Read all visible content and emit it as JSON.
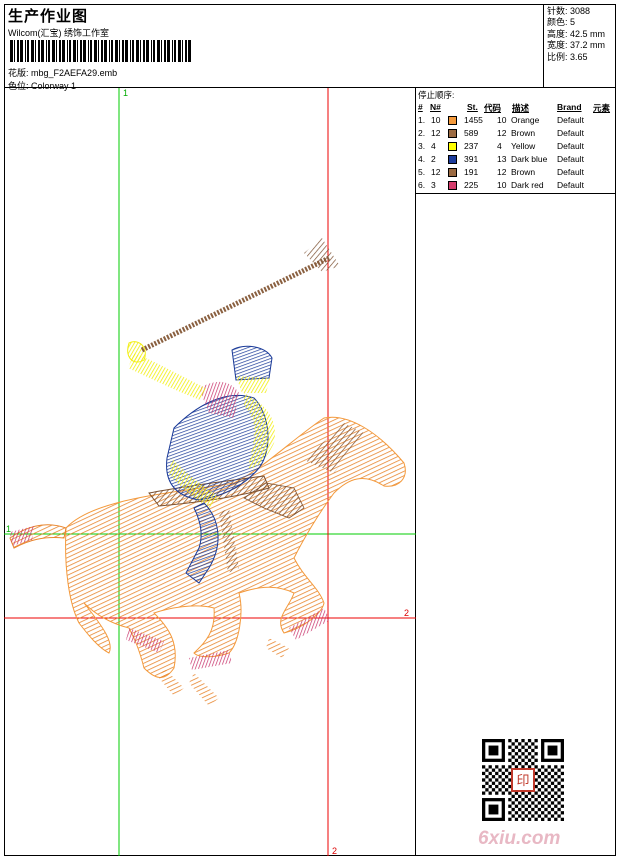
{
  "header": {
    "title": "生产作业图",
    "studio": "Wilcom(汇宝) 绣饰工作室",
    "file_label": "花版:",
    "file_name": "mbg_F2AEFA29.emb",
    "colorway_label": "色位:",
    "colorway": "Colorway 1"
  },
  "specs": [
    {
      "label": "针数:",
      "value": "3088"
    },
    {
      "label": "颜色:",
      "value": "5"
    },
    {
      "label": "高度:",
      "value": "42.5 mm"
    },
    {
      "label": "宽度:",
      "value": "37.2 mm"
    },
    {
      "label": "比例:",
      "value": "3.65"
    }
  ],
  "stop_sequence": {
    "title": "停止顺序:",
    "columns": [
      "#",
      "N#",
      "St.",
      "代码",
      "描述",
      "Brand",
      "元素"
    ],
    "rows": [
      {
        "idx": "1.",
        "n": "10",
        "color": "#F49A3C",
        "st": "1455",
        "code": "10",
        "desc": "Orange",
        "brand": "Default"
      },
      {
        "idx": "2.",
        "n": "12",
        "color": "#9B6A42",
        "st": "589",
        "code": "12",
        "desc": "Brown",
        "brand": "Default"
      },
      {
        "idx": "3.",
        "n": "4",
        "color": "#FFFF00",
        "st": "237",
        "code": "4",
        "desc": "Yellow",
        "brand": "Default"
      },
      {
        "idx": "4.",
        "n": "2",
        "color": "#1C3C9C",
        "st": "391",
        "code": "13",
        "desc": "Dark blue",
        "brand": "Default"
      },
      {
        "idx": "5.",
        "n": "12",
        "color": "#9B6A42",
        "st": "191",
        "code": "12",
        "desc": "Brown",
        "brand": "Default"
      },
      {
        "idx": "6.",
        "n": "3",
        "color": "#D43C6C",
        "st": "225",
        "code": "10",
        "desc": "Dark red",
        "brand": "Default"
      }
    ]
  },
  "guides": {
    "v1": "1",
    "h1": "1",
    "h2": "2",
    "v2": "2"
  },
  "watermark": "6xiu.com",
  "seal_text": "印"
}
